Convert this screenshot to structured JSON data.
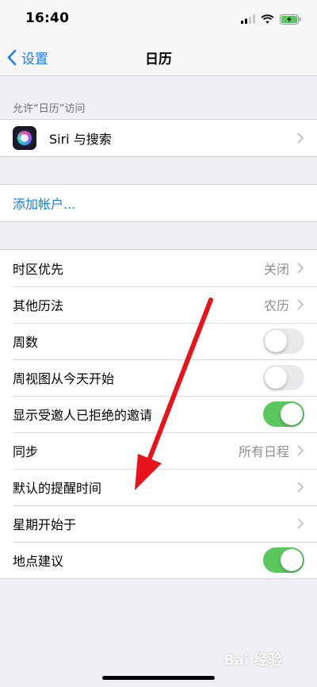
{
  "status_bar": {
    "time": "16:40"
  },
  "nav": {
    "back_label": "设置",
    "title": "日历"
  },
  "access_section": {
    "header": "允许“日历”访问",
    "siri_label": "Siri 与搜索"
  },
  "accounts": {
    "add_account_label": "添加帐户..."
  },
  "settings": {
    "timezone": {
      "label": "时区优先",
      "value": "关闭"
    },
    "other_calendar": {
      "label": "其他历法",
      "value": "农历"
    },
    "week_numbers": {
      "label": "周数",
      "toggle": "off"
    },
    "week_view_today": {
      "label": "周视图从今天开始",
      "toggle": "off"
    },
    "declined_events": {
      "label": "显示受邀人已拒绝的邀请",
      "toggle": "on"
    },
    "sync": {
      "label": "同步",
      "value": "所有日程"
    },
    "default_alert_times": {
      "label": "默认的提醒时间"
    },
    "start_week_on": {
      "label": "星期开始于"
    },
    "location_suggestions": {
      "label": "地点建议",
      "toggle": "on"
    }
  },
  "colors": {
    "accent": "#1a7cf0",
    "toggle_on": "#5ac85f",
    "toggle_off": "#e9e9eb",
    "background": "#efeff4",
    "annotation_arrow": "#e8141c"
  },
  "watermark": {
    "text": "Bai 经验"
  }
}
